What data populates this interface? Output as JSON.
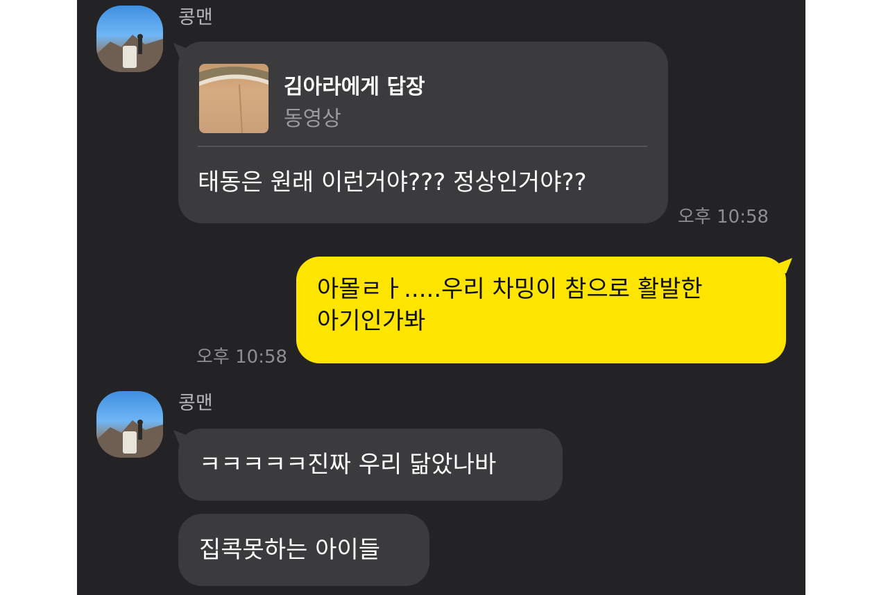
{
  "chat": {
    "messages": [
      {
        "sender": "콩맨",
        "reply": {
          "title": "김아라에게 답장",
          "subtitle": "동영상"
        },
        "text": "태동은 원래 이런거야??? 정상인거야??",
        "time": "오후 10:58"
      },
      {
        "sender": "me",
        "lines": [
          "아몰ㄹㅏ.....우리 차밍이 참으로 활발한",
          "아기인가봐"
        ],
        "time": "오후 10:58"
      },
      {
        "sender": "콩맨",
        "text": "ㅋㅋㅋㅋㅋ진짜 우리 닮았나바"
      },
      {
        "sender": "콩맨",
        "text": "집콕못하는 아이들"
      }
    ]
  },
  "colors": {
    "background": "#232325",
    "incoming_bubble": "#3b3b3d",
    "outgoing_bubble": "#fee500",
    "timestamp": "#8e8e92"
  }
}
